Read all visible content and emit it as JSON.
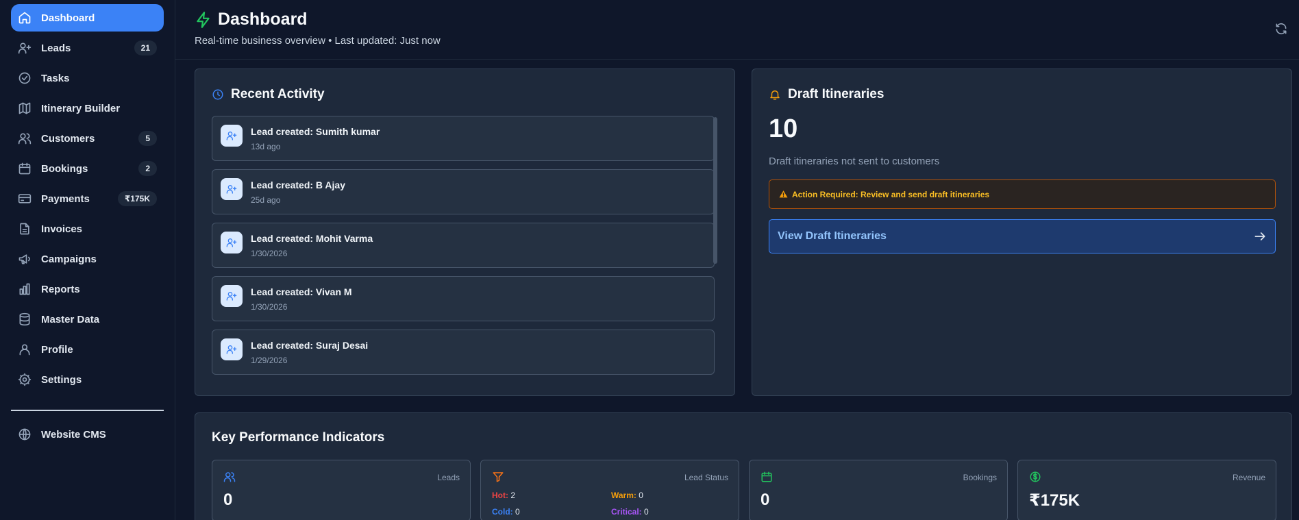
{
  "sidebar": {
    "items": [
      {
        "label": "Dashboard",
        "icon": "home-icon",
        "badge": null,
        "active": true
      },
      {
        "label": "Leads",
        "icon": "user-plus-icon",
        "badge": "21"
      },
      {
        "label": "Tasks",
        "icon": "check-circle-icon",
        "badge": null
      },
      {
        "label": "Itinerary Builder",
        "icon": "map-icon",
        "badge": null
      },
      {
        "label": "Customers",
        "icon": "users-icon",
        "badge": "5"
      },
      {
        "label": "Bookings",
        "icon": "calendar-icon",
        "badge": "2"
      },
      {
        "label": "Payments",
        "icon": "credit-card-icon",
        "badge": "₹175K"
      },
      {
        "label": "Invoices",
        "icon": "file-icon",
        "badge": null
      },
      {
        "label": "Campaigns",
        "icon": "megaphone-icon",
        "badge": null
      },
      {
        "label": "Reports",
        "icon": "bar-chart-icon",
        "badge": null
      },
      {
        "label": "Master Data",
        "icon": "database-icon",
        "badge": null
      },
      {
        "label": "Profile",
        "icon": "user-icon",
        "badge": null
      },
      {
        "label": "Settings",
        "icon": "gear-icon",
        "badge": null
      }
    ],
    "cms": {
      "label": "Website CMS",
      "icon": "globe-icon"
    }
  },
  "header": {
    "title": "Dashboard",
    "subtitle": "Real-time business overview • Last updated: Just now"
  },
  "recent_activity": {
    "title": "Recent Activity",
    "items": [
      {
        "title": "Lead created: Sumith kumar",
        "time": "13d ago"
      },
      {
        "title": "Lead created: B Ajay",
        "time": "25d ago"
      },
      {
        "title": "Lead created: Mohit Varma",
        "time": "1/30/2026"
      },
      {
        "title": "Lead created: Vivan M",
        "time": "1/30/2026"
      },
      {
        "title": "Lead created: Suraj Desai",
        "time": "1/29/2026"
      }
    ]
  },
  "draft": {
    "title": "Draft Itineraries",
    "count": "10",
    "description": "Draft itineraries not sent to customers",
    "alert": "Action Required: Review and send draft itineraries",
    "button": "View Draft Itineraries"
  },
  "kpi": {
    "title": "Key Performance Indicators",
    "leads": {
      "label": "Leads",
      "value": "0"
    },
    "lead_status": {
      "label": "Lead Status",
      "hot_label": "Hot:",
      "hot": "2",
      "warm_label": "Warm:",
      "warm": "0",
      "cold_label": "Cold:",
      "cold": "0",
      "critical_label": "Critical:",
      "critical": "0"
    },
    "bookings": {
      "label": "Bookings",
      "value": "0"
    },
    "revenue": {
      "label": "Revenue",
      "value": "₹175K"
    }
  },
  "colors": {
    "accent": "#3b82f6",
    "background": "#0f172a",
    "panel": "#1e293b",
    "hot": "#ef4444",
    "warm": "#f59e0b",
    "cold": "#3b82f6",
    "critical": "#a855f7",
    "success": "#22c55e"
  }
}
